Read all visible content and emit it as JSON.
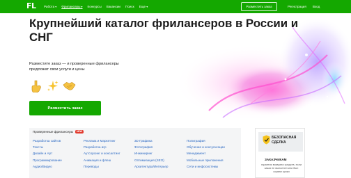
{
  "header": {
    "logo": "FL",
    "nav": [
      {
        "label": "Работа",
        "dropdown": true,
        "active": false
      },
      {
        "label": "Фрилансеры",
        "dropdown": true,
        "active": true
      },
      {
        "label": "Конкурсы",
        "dropdown": false,
        "active": false
      },
      {
        "label": "Вакансии",
        "dropdown": false,
        "active": false
      },
      {
        "label": "Поиск",
        "dropdown": false,
        "active": false
      },
      {
        "label": "Еще",
        "dropdown": true,
        "active": false
      }
    ],
    "post_order_button": "Разместить заказ",
    "register": "Регистрация",
    "login": "Вход"
  },
  "hero": {
    "title": "Крупнейший каталог фрилансеров в России и СНГ",
    "subtitle": "Разместите заказ — и проверенные фрилансеры предложат свои услуги и цены",
    "emoji": [
      "pointing-hand",
      "sparkles",
      "handshake"
    ],
    "cta": "Разместить заказ"
  },
  "catalog": {
    "heading": "Проверенные фрилансеры",
    "badge": "NEW",
    "columns": [
      [
        "Разработка сайтов",
        "Тексты",
        "Дизайн и Арт",
        "Программирование",
        "Аудио/Видео"
      ],
      [
        "Реклама и Маркетинг",
        "Разработка игр",
        "Аутсорсинг и консалтинг",
        "Анимация и флеш",
        "Переводы"
      ],
      [
        "3D Графика",
        "Фотография",
        "Инжиниринг",
        "Оптимизация (SEO)",
        "Архитектура/Интерьер"
      ],
      [
        "Полиграфия",
        "Обучение и консультации",
        "Менеджмент",
        "Мобильные приложения",
        "Сети и инфосистемы"
      ]
    ]
  },
  "safe_deal": {
    "title_line1": "БЕЗОПАСНАЯ",
    "title_line2": "СДЕЛКА",
    "audience": "ЗАКАЗЧИКАМ",
    "text": "гарантия возврата средств, если заказ не выполнен или был сорван сроки"
  },
  "colors": {
    "brand_green": "#14a800",
    "link_blue": "#2b69c3",
    "badge_red": "#e23b2e",
    "catalog_bg": "#f4f5f6"
  }
}
